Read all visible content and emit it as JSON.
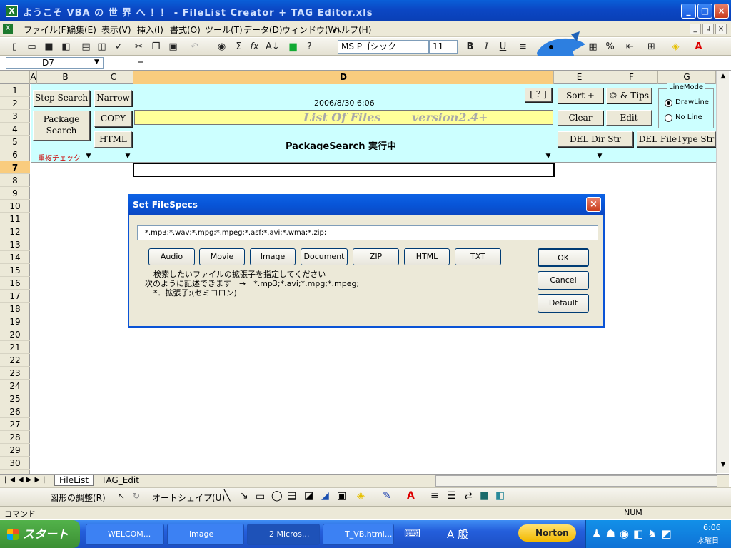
{
  "window": {
    "title": "ようこそ VBA の 世 界 へ ！！ - FileList Creator + TAG Editor.xls",
    "min": "_",
    "max": "□",
    "close": "×"
  },
  "menu": {
    "items": [
      "ファイル(F)",
      "編集(E)",
      "表示(V)",
      "挿入(I)",
      "書式(O)",
      "ツール(T)",
      "データ(D)",
      "ウィンドウ(W)",
      "ヘルプ(H)"
    ],
    "mdi": [
      "_",
      "ﾛ",
      "×"
    ]
  },
  "toolbar": {
    "font": "MS Pゴシック",
    "size": "11",
    "bold": "B",
    "italic": "I",
    "underline": "U",
    "sum": "Σ",
    "fx": "fx",
    "sort": "A↓",
    "pct": "%",
    "fontcolor": "A"
  },
  "formula": {
    "namebox": "D7",
    "equals": "="
  },
  "columns": [
    "A",
    "B",
    "C",
    "D",
    "E",
    "F",
    "G"
  ],
  "rows": [
    "1",
    "2",
    "3",
    "4",
    "5",
    "6",
    "7",
    "8",
    "9",
    "10",
    "11",
    "12",
    "13",
    "14",
    "15",
    "16",
    "17",
    "18",
    "19",
    "20",
    "21",
    "22",
    "23",
    "24",
    "25",
    "26",
    "27",
    "28",
    "29",
    "30"
  ],
  "sheet": {
    "step_search": "Step Search",
    "narrow": "Narrow",
    "package_search_1": "Package",
    "package_search_2": "Search",
    "copy": "COPY",
    "html": "HTML",
    "help_btn": "[ ? ]",
    "sort_plus": "Sort +",
    "tips": "© & Tips",
    "clear": "Clear",
    "edit": "Edit",
    "del_dir": "DEL Dir Str",
    "del_filetype": "DEL FileType Str",
    "date": "2006/8/30 6:06",
    "list_title": "List Of Files",
    "version": "version2.4+",
    "status": "PackageSearch 実行中",
    "dup_check": "重複チェック",
    "linemode_label": "LineMode",
    "drawline": "DrawLine",
    "noline": "No Line"
  },
  "sheettabs": [
    "FileList",
    "TAG_Edit"
  ],
  "drawing": {
    "adjust": "図形の調整(R)",
    "autoshape": "オートシェイプ(U)"
  },
  "statusbar": {
    "mode": "コマンド",
    "num": "NUM"
  },
  "dialog": {
    "title": "Set FileSpecs",
    "close": "×",
    "filespec": "*.mp3;*.wav;*.mpg;*.mpeg;*.asf;*.avi;*.wma;*.zip;",
    "buttons": [
      "Audio",
      "Movie",
      "Image",
      "Document",
      "ZIP",
      "HTML",
      "TXT"
    ],
    "ok": "OK",
    "cancel": "Cancel",
    "default": "Default",
    "help1": "検索したいファイルの拡張子を指定してください",
    "help2": "次のように記述できます　→　*.mp3;*.avi;*.mpg;*.mpeg;",
    "help3": "*．拡張子;(セミコロン)"
  },
  "taskbar": {
    "start": "スタート",
    "tasks": [
      "WELCOM...",
      "image",
      "2 Micros...",
      "T_VB.html..."
    ],
    "ime": "A 般",
    "norton": "Norton",
    "time": "6:06",
    "day": "水曜日"
  }
}
